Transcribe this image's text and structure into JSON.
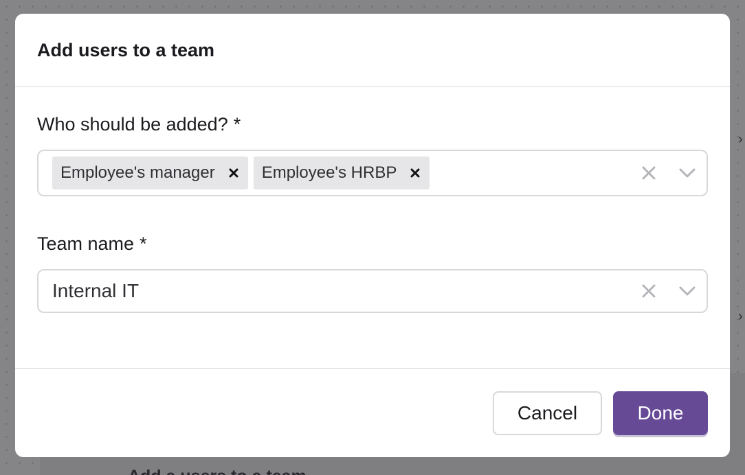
{
  "background": {
    "card_text": "Add a users to a team",
    "chevron": "›"
  },
  "dialog": {
    "title": "Add users to a team",
    "who_field": {
      "label": "Who should be added?",
      "required_mark": "*",
      "chips": [
        {
          "label": "Employee's manager",
          "remove_icon": "close-icon"
        },
        {
          "label": "Employee's HRBP",
          "remove_icon": "close-icon"
        }
      ],
      "clear_icon": "clear-icon",
      "dropdown_icon": "chevron-down-icon"
    },
    "team_field": {
      "label": "Team name",
      "required_mark": "*",
      "value": "Internal IT",
      "clear_icon": "clear-icon",
      "dropdown_icon": "chevron-down-icon"
    },
    "footer": {
      "cancel_label": "Cancel",
      "done_label": "Done"
    }
  },
  "colors": {
    "primary": "#664a96",
    "overlay": "#858486",
    "chip_bg": "#e6e6e8",
    "border": "#d8d8dc"
  }
}
